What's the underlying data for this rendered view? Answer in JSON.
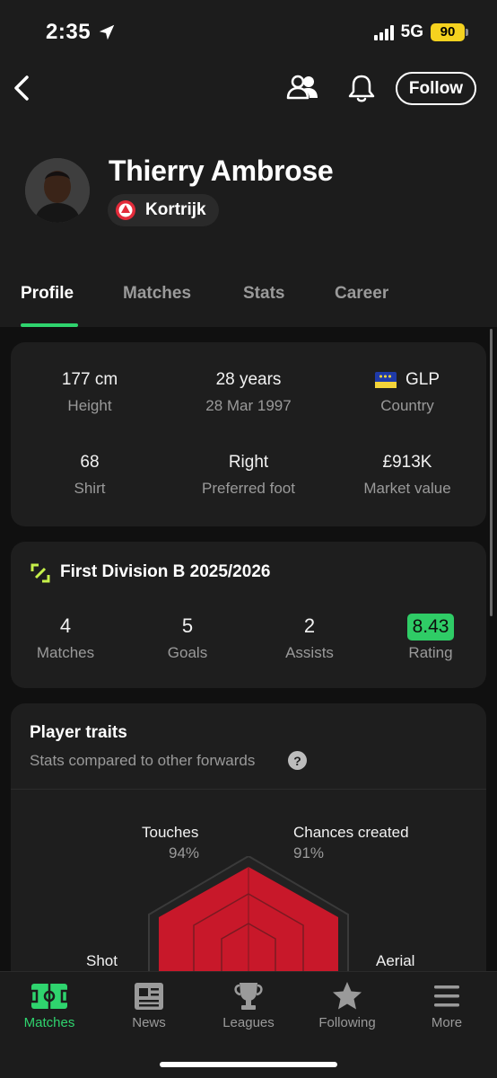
{
  "status_bar": {
    "time": "2:35",
    "network": "5G",
    "battery": "90"
  },
  "header": {
    "follow_label": "Follow"
  },
  "player": {
    "name": "Thierry Ambrose",
    "team": "Kortrijk"
  },
  "tabs": [
    {
      "label": "Profile",
      "active": true
    },
    {
      "label": "Matches",
      "active": false
    },
    {
      "label": "Stats",
      "active": false
    },
    {
      "label": "Career",
      "active": false
    }
  ],
  "info": {
    "height": {
      "value": "177 cm",
      "label": "Height"
    },
    "age": {
      "value": "28 years",
      "label": "28 Mar 1997"
    },
    "country": {
      "value": "GLP",
      "label": "Country"
    },
    "shirt": {
      "value": "68",
      "label": "Shirt"
    },
    "foot": {
      "value": "Right",
      "label": "Preferred foot"
    },
    "market": {
      "value": "£913K",
      "label": "Market value"
    }
  },
  "league": {
    "title": "First Division B 2025/2026",
    "stats": [
      {
        "value": "4",
        "label": "Matches"
      },
      {
        "value": "5",
        "label": "Goals"
      },
      {
        "value": "2",
        "label": "Assists"
      },
      {
        "value": "8.43",
        "label": "Rating"
      }
    ]
  },
  "traits": {
    "title": "Player traits",
    "subtitle": "Stats compared to other forwards",
    "help": "?",
    "items": [
      {
        "label": "Touches",
        "pct": "94%"
      },
      {
        "label": "Chances created",
        "pct": "91%"
      },
      {
        "label": "Shot",
        "pct": ""
      },
      {
        "label": "Aerial",
        "pct": ""
      }
    ],
    "fill_color": "#c8182a"
  },
  "bottom_nav": [
    {
      "label": "Matches",
      "icon": "pitch-icon",
      "active": true
    },
    {
      "label": "News",
      "icon": "newspaper-icon",
      "active": false
    },
    {
      "label": "Leagues",
      "icon": "trophy-icon",
      "active": false
    },
    {
      "label": "Following",
      "icon": "star-icon",
      "active": false
    },
    {
      "label": "More",
      "icon": "menu-icon",
      "active": false
    }
  ],
  "colors": {
    "accent": "#2fd46e",
    "rating": "#2fcc66",
    "battery": "#f5d21f"
  }
}
